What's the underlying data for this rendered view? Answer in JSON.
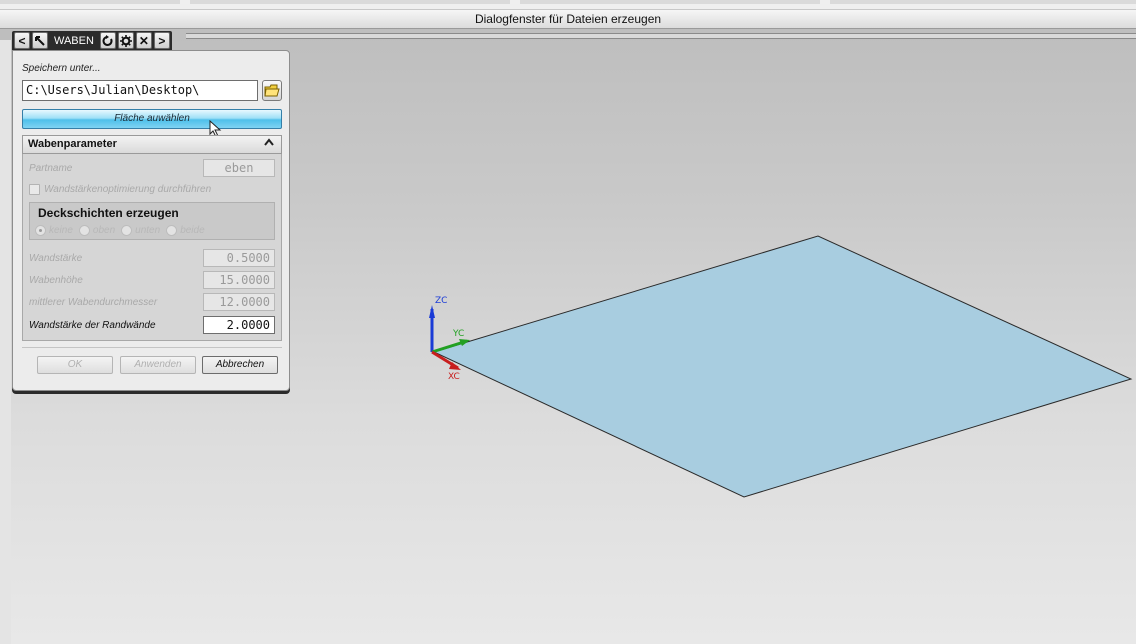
{
  "window": {
    "title": "Dialogfenster für Dateien erzeugen"
  },
  "toolbar": {
    "title": "WABEN",
    "prev_label": "<",
    "next_label": ">",
    "close_label": "✕",
    "icons": [
      "arrow-icon",
      "reset-icon",
      "gear-icon",
      "close-icon"
    ]
  },
  "dialog": {
    "save_as_label": "Speichern unter...",
    "path_value": "C:\\Users\\Julian\\Desktop\\",
    "select_face_label": "Fläche auwählen",
    "group": {
      "title": "Wabenparameter",
      "partname_label": "Partname",
      "partname_value": "eben",
      "optimize_label": "Wandstärkenoptimierung durchführen",
      "optimize_checked": false,
      "cover": {
        "title": "Deckschichten erzeugen",
        "options": [
          "keine",
          "oben",
          "unten",
          "beide"
        ],
        "selected": "keine"
      },
      "wall_thickness_label": "Wandstärke",
      "wall_thickness_value": "0.5000",
      "honeycomb_height_label": "Wabenhöhe",
      "honeycomb_height_value": "15.0000",
      "mean_diameter_label": "mittlerer Wabendurchmesser",
      "mean_diameter_value": "12.0000",
      "edge_wall_label": "Wandstärke der Randwände",
      "edge_wall_value": "2.0000"
    },
    "buttons": {
      "ok": "OK",
      "apply": "Anwenden",
      "cancel": "Abbrechen"
    }
  },
  "scene": {
    "axis_labels": {
      "z": "ZC",
      "y": "YC",
      "x": "XC"
    },
    "colors": {
      "plane_fill": "#a8cde0",
      "axis_z": "#1a3bd6",
      "axis_y": "#22a022",
      "axis_x": "#c81e1e"
    }
  }
}
